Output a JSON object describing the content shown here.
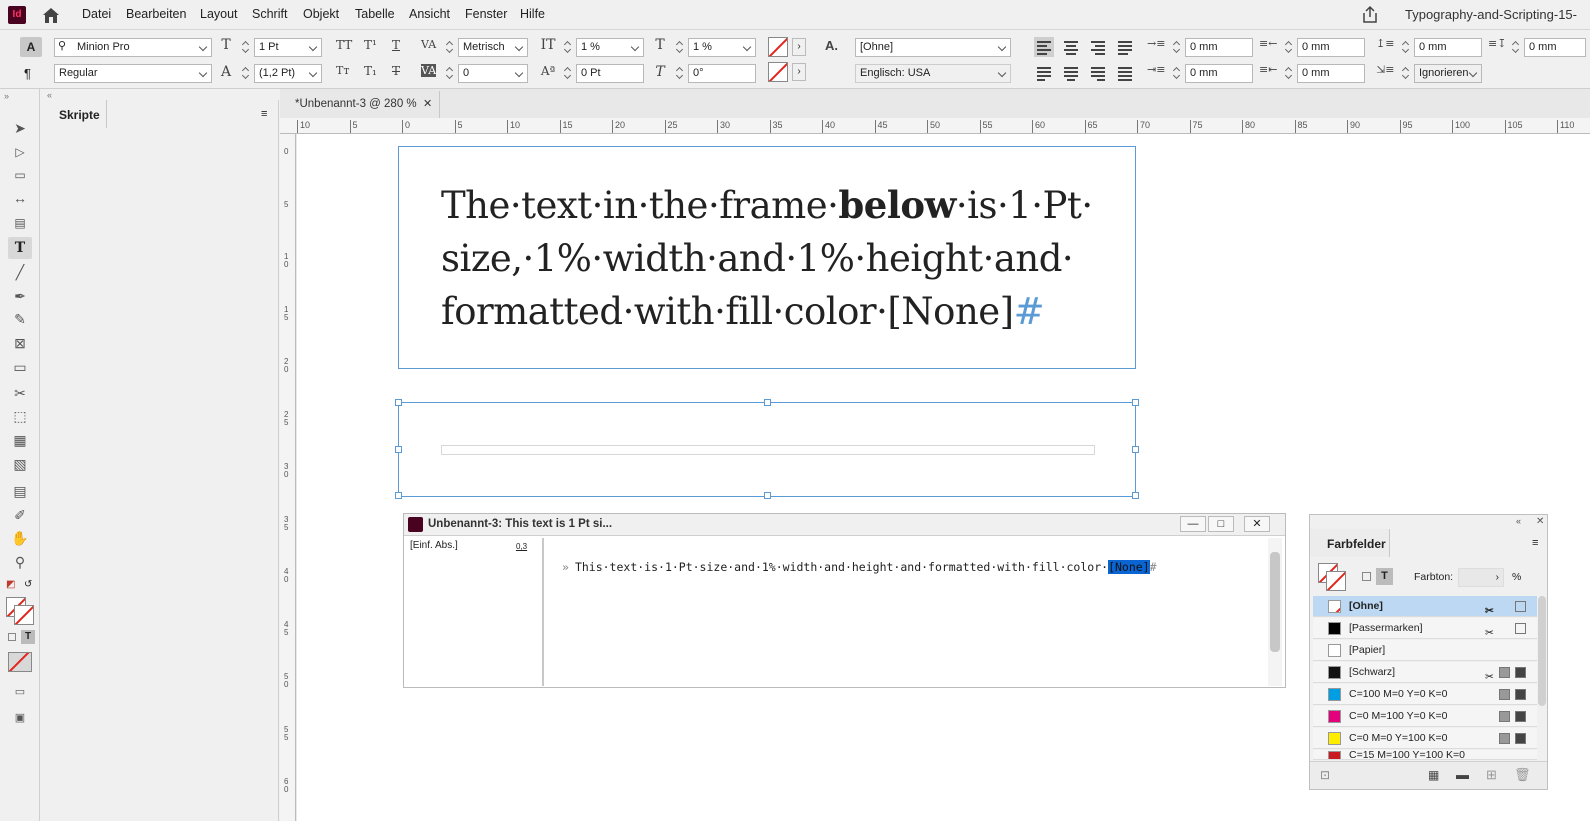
{
  "app": {
    "logo": "Id",
    "document_title": "Typography-and-Scripting-15-"
  },
  "menu": [
    "Datei",
    "Bearbeiten",
    "Layout",
    "Schrift",
    "Objekt",
    "Tabelle",
    "Ansicht",
    "Fenster",
    "Hilfe"
  ],
  "control": {
    "font_family": "Minion Pro",
    "font_style": "Regular",
    "font_size": "1 Pt",
    "leading": "(1,2 Pt)",
    "kerning": "Metrisch",
    "tracking": "0",
    "vertical_scale": "1 %",
    "horizontal_scale": "1 %",
    "baseline_shift": "0 Pt",
    "skew": "0°",
    "char_style": "[Ohne]",
    "language": "Englisch: USA",
    "left_indent": "0 mm",
    "right_indent": "0 mm",
    "first_line_indent": "0 mm",
    "last_line_indent": "0 mm",
    "space_before": "0 mm",
    "space_after": "0 mm",
    "grid_align": "Ignorieren"
  },
  "panels": {
    "scripts_tab": "Skripte",
    "swatches_tab": "Farbfelder"
  },
  "document": {
    "tab_label": "*Unbenannt-3 @ 280 %",
    "ruler_h": [
      "10",
      "5",
      "0",
      "5",
      "10",
      "15",
      "20",
      "25",
      "30",
      "35",
      "40",
      "45",
      "50",
      "55",
      "60",
      "65",
      "70",
      "75",
      "80",
      "85",
      "90",
      "95",
      "100",
      "105",
      "110"
    ],
    "ruler_v": [
      "0",
      "5",
      "1\n0",
      "1\n5",
      "2\n0",
      "2\n5",
      "3\n0",
      "3\n5",
      "4\n0",
      "4\n5",
      "5\n0",
      "5\n5",
      "6\n0"
    ],
    "frame1_part1": "The·text·in·the·frame·",
    "frame1_bold": "below",
    "frame1_part2": "·is·1·Pt· size,·1%·width·and·1%·height·and· formatted·with·fill·color·[None]",
    "frame1_end": "#"
  },
  "story_editor": {
    "title": "Unbenannt-3: This text is 1 Pt si...",
    "style_name": "[Einf. Abs.]",
    "depth": "0,3",
    "marker": "»",
    "text": "This·text·is·1·Pt·size·and·1%·width·and·height·and·formatted·with·fill·color·",
    "selected": "[None]",
    "end": "#"
  },
  "swatches": {
    "tint_label": "Farbton:",
    "tint_unit": "%",
    "items": [
      {
        "name": "[Ohne]",
        "color": "none"
      },
      {
        "name": "[Passermarken]",
        "color": "#000000"
      },
      {
        "name": "[Papier]",
        "color": "#ffffff"
      },
      {
        "name": "[Schwarz]",
        "color": "#111111"
      },
      {
        "name": "C=100 M=0 Y=0 K=0",
        "color": "#009fe3"
      },
      {
        "name": "C=0 M=100 Y=0 K=0",
        "color": "#e4007d"
      },
      {
        "name": "C=0 M=0 Y=100 K=0",
        "color": "#ffed00"
      },
      {
        "name": "C=15 M=100 Y=100 K=0",
        "color": "#c91a22"
      }
    ]
  }
}
